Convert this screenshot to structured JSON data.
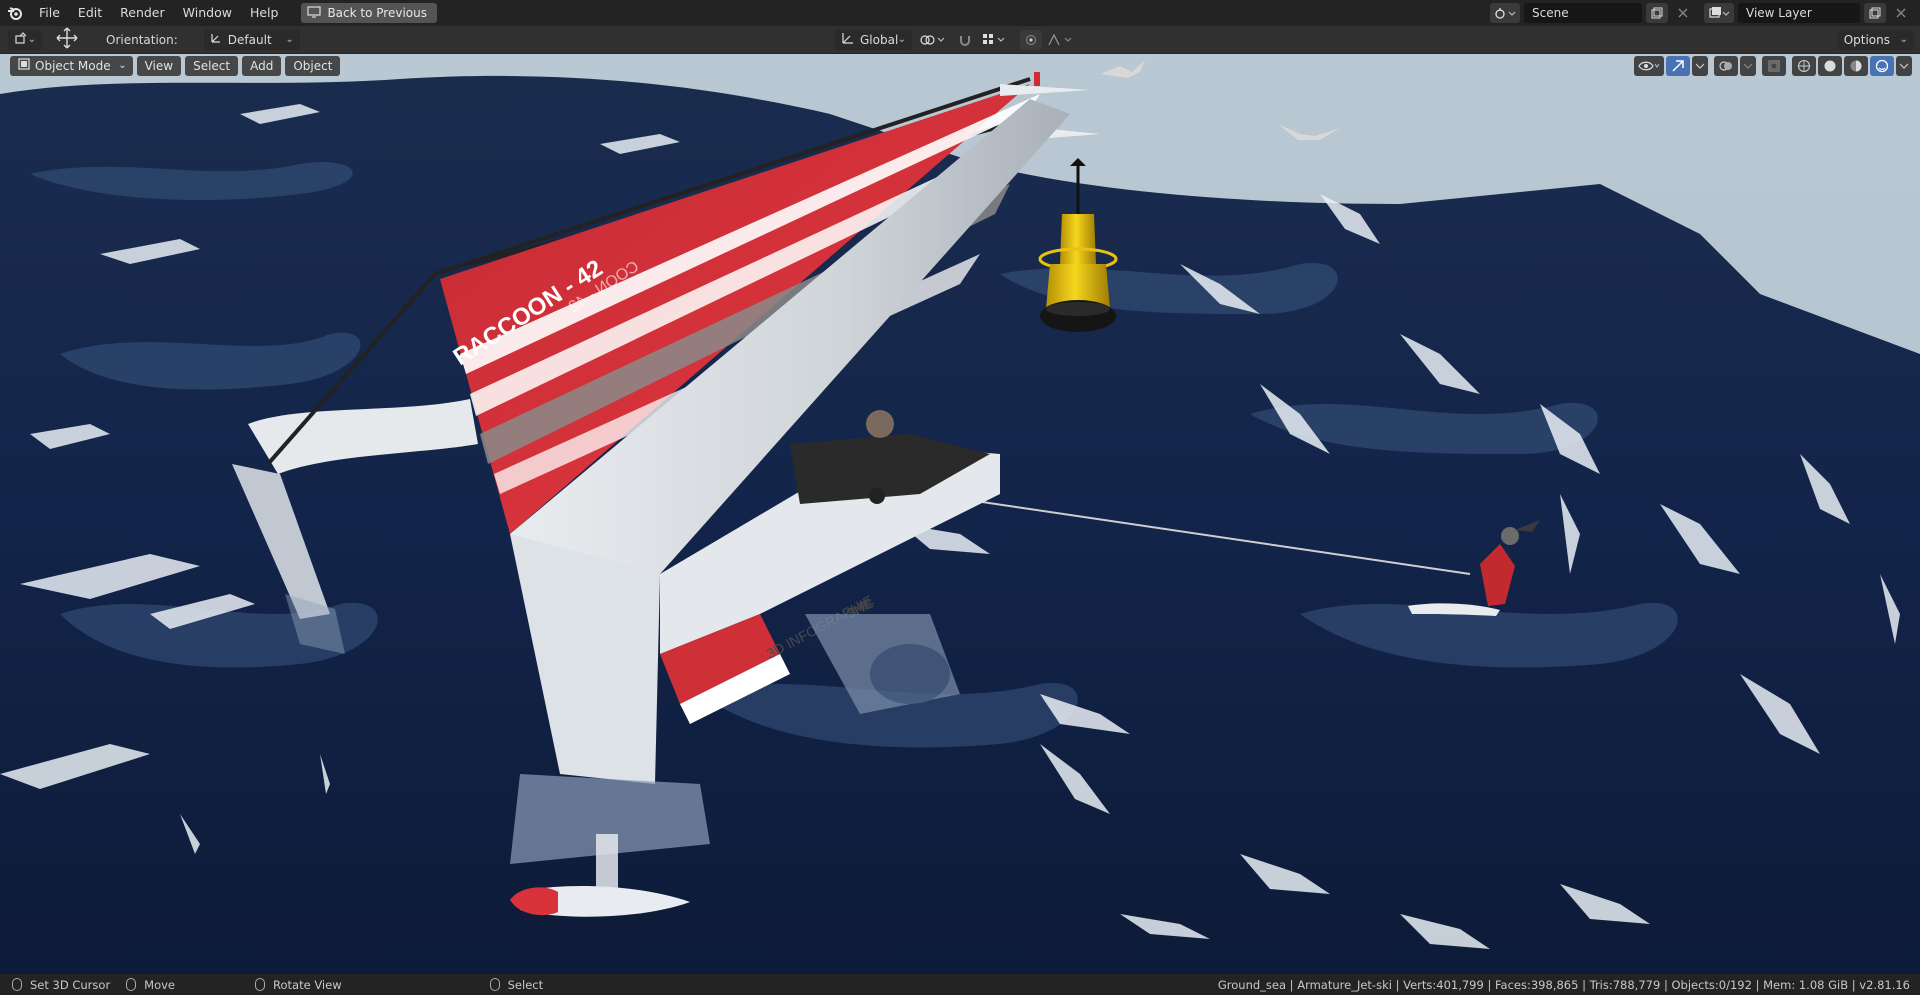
{
  "topbar": {
    "menus": [
      "File",
      "Edit",
      "Render",
      "Window",
      "Help"
    ],
    "back_button": "Back to Previous",
    "scene_name": "Scene",
    "view_layer": "View Layer"
  },
  "toolheader": {
    "orientation_label": "Orientation:",
    "orientation_value": "Default",
    "transform_orientation": "Global",
    "options_label": "Options"
  },
  "viewport": {
    "mode": "Object Mode",
    "menu_view": "View",
    "menu_select": "Select",
    "menu_add": "Add",
    "menu_object": "Object",
    "sail_text": "RACCOON - 42",
    "sail_text_mirrored": "COON - 42",
    "hull_text": "3D INFOGRAPHIE",
    "hull_logo": "3HE"
  },
  "statusbar": {
    "left_click": "Set 3D Cursor",
    "middle_click": "Move",
    "rotate": "Rotate View",
    "right_click": "Select",
    "stats": "Ground_sea | Armature_Jet-ski | Verts:401,799 | Faces:398,865 | Tris:788,779 | Objects:0/192 | Mem: 1.08 GiB | v2.81.16"
  },
  "colors": {
    "accent": "#4772b3",
    "sail_red": "#d9343c",
    "sea_dark": "#0f1d3c",
    "buoy_yellow": "#f2cd12"
  }
}
